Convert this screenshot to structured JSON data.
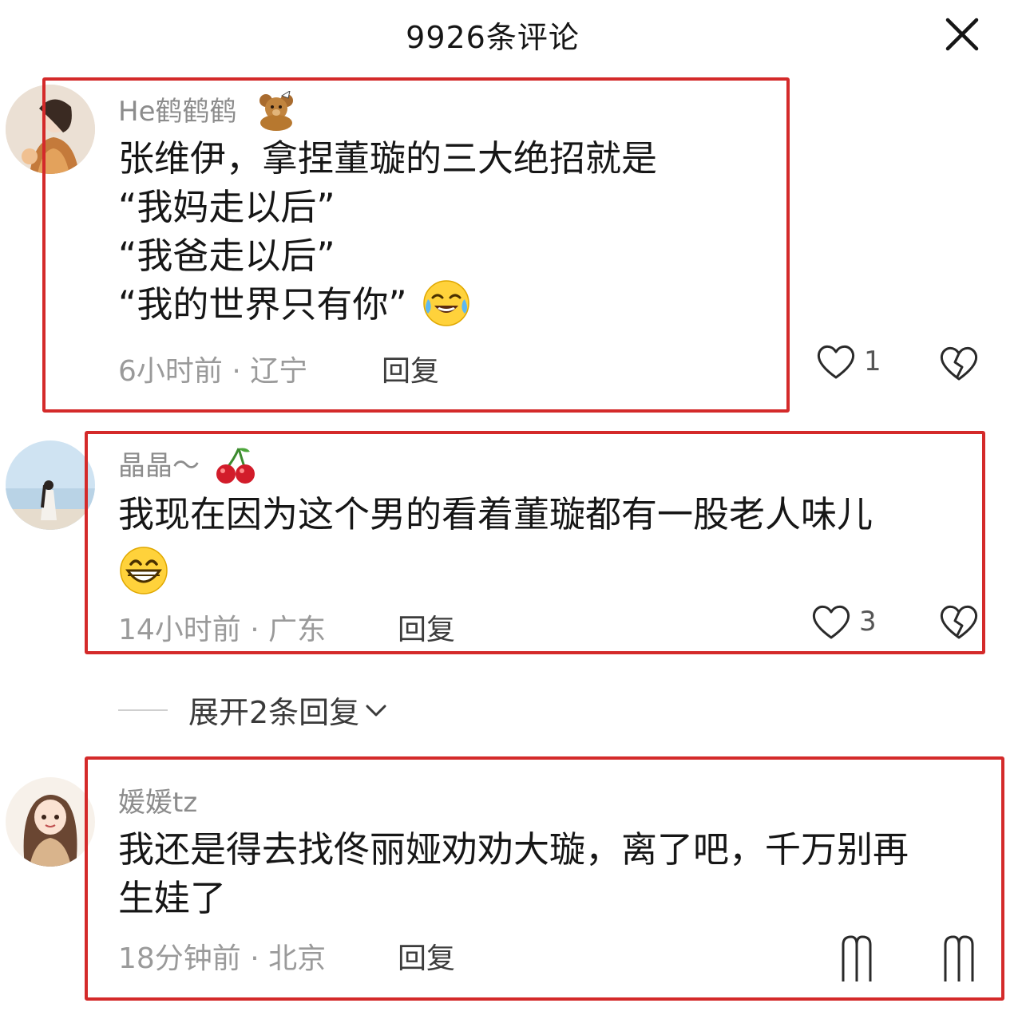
{
  "header": {
    "title": "9926条评论"
  },
  "comments": [
    {
      "username": "He鹤鹤鹤",
      "lines": [
        "张维伊，拿捏董璇的三大绝招就是",
        "“我妈走以后”",
        "“我爸走以后”",
        "“我的世界只有你”"
      ],
      "meta": "6小时前 · 辽宁",
      "reply_label": "回复",
      "likes": "1"
    },
    {
      "username": "晶晶～",
      "lines": [
        "我现在因为这个男的看着董璇都有一股老人味儿"
      ],
      "meta": "14小时前 · 广东",
      "reply_label": "回复",
      "likes": "3"
    },
    {
      "username": "媛媛tz",
      "lines": [
        "我还是得去找佟丽娅劝劝大璇，离了吧，千万别再",
        "生娃了"
      ],
      "meta": "18分钟前 · 北京",
      "reply_label": "回复"
    }
  ],
  "expand": {
    "label": "展开2条回复"
  },
  "colors": {
    "highlight_box": "#d42a2a",
    "muted_text": "#8c8c8c",
    "body_text": "#161616"
  },
  "icons": {
    "close": "close-icon",
    "like": "heart-icon",
    "dislike": "broken-heart-icon",
    "chevron": "chevron-down-icon"
  }
}
